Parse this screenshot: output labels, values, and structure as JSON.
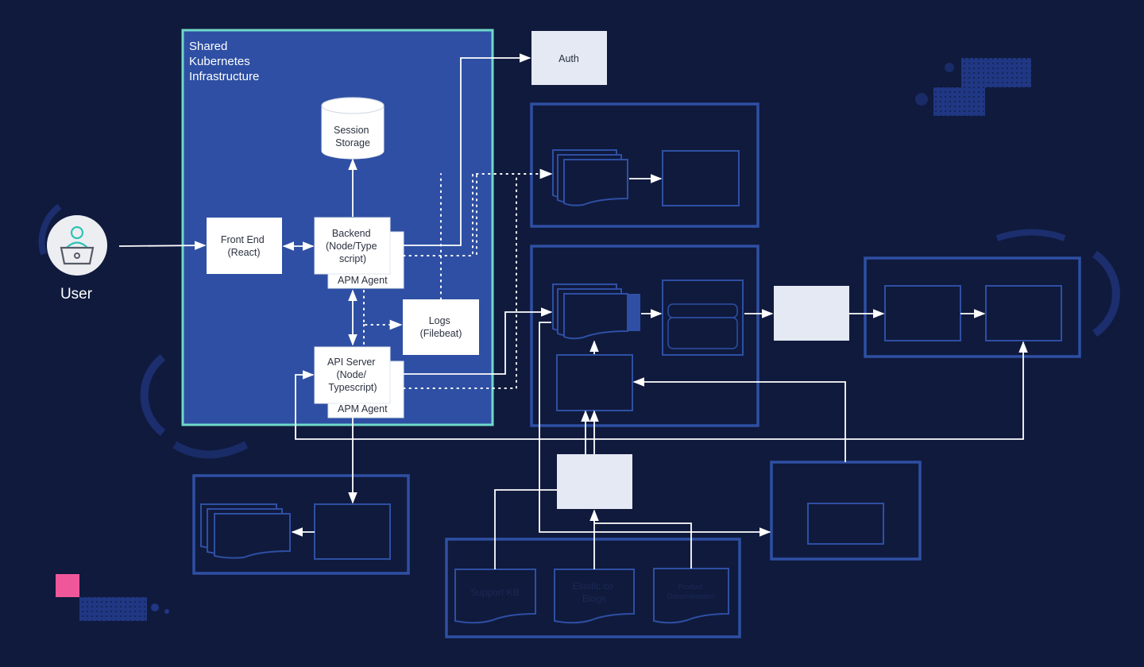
{
  "colors": {
    "background": "#101a3d",
    "k8s_fill": "#2e4fa3",
    "k8s_border": "#6fd9c9",
    "outline_blue": "#2e4fa3",
    "light_box": "#e4e9f3",
    "white_box": "#ffffff",
    "pink_accent": "#f0579b",
    "user_teal": "#2ec4b6",
    "text_dark": "#2b3140",
    "text_white": "#ffffff",
    "faint_doc_text": "#1b2a55"
  },
  "user": {
    "label": "User",
    "icon": "user-laptop-icon"
  },
  "k8s": {
    "title_lines": [
      "Shared",
      "Kubernetes",
      "Infrastructure"
    ]
  },
  "nodes": {
    "session_storage": [
      "Session",
      "Storage"
    ],
    "front_end": [
      "Front End",
      "(React)"
    ],
    "backend": [
      "Backend",
      "(Node/Type",
      "script)"
    ],
    "backend_agent": "APM Agent",
    "logs": [
      "Logs",
      "(Filebeat)"
    ],
    "api_server": [
      "API Server",
      "(Node/",
      "Typescript)"
    ],
    "api_agent": "APM Agent",
    "auth": "Auth"
  },
  "sources": {
    "docs": [
      {
        "lines": [
          "Support KB"
        ]
      },
      {
        "lines": [
          "Elastic.co",
          "Blogs"
        ]
      },
      {
        "lines": [
          "Product",
          "Documentation"
        ]
      }
    ]
  }
}
